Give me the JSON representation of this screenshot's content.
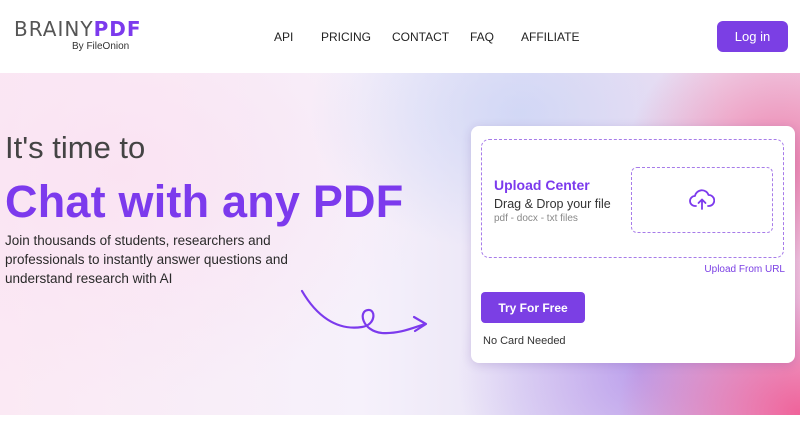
{
  "header": {
    "logo": {
      "part1": "BRAINY",
      "part2": "PDF",
      "sub": "By FileOnion"
    },
    "nav": [
      {
        "label": "API"
      },
      {
        "label": "PRICING"
      },
      {
        "label": "CONTACT"
      },
      {
        "label": "FAQ"
      },
      {
        "label": "AFFILIATE"
      }
    ],
    "login_label": "Log in"
  },
  "hero": {
    "pre_title": "It's time to",
    "title": "Chat with any PDF",
    "description": "Join thousands of students, researchers and professionals to instantly answer questions and understand research with AI"
  },
  "upload_card": {
    "title": "Upload Center",
    "drag_text": "Drag & Drop your file",
    "file_types": "pdf - docx - txt files",
    "upload_icon": "cloud-upload-icon",
    "url_link": "Upload From URL",
    "try_label": "Try For Free",
    "no_card_text": "No Card Needed"
  },
  "colors": {
    "brand": "#7c3aed",
    "button": "#7b3fe4",
    "dashed_border": "#a77be9"
  }
}
